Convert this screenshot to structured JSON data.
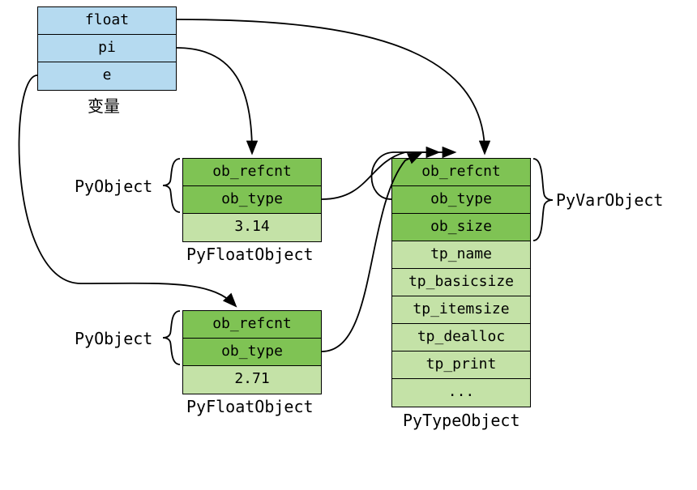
{
  "vars_box": {
    "rows": [
      "float",
      "pi",
      "e"
    ],
    "caption": "变量"
  },
  "float1": {
    "rows": [
      "ob_refcnt",
      "ob_type",
      "3.14"
    ],
    "caption": "PyFloatObject",
    "brace_label": "PyObject"
  },
  "float2": {
    "rows": [
      "ob_refcnt",
      "ob_type",
      "2.71"
    ],
    "caption": "PyFloatObject",
    "brace_label": "PyObject"
  },
  "typeobj": {
    "rows": [
      "ob_refcnt",
      "ob_type",
      "ob_size",
      "tp_name",
      "tp_basicsize",
      "tp_itemsize",
      "tp_dealloc",
      "tp_print",
      "..."
    ],
    "caption": "PyTypeObject",
    "brace_label": "PyVarObject"
  }
}
